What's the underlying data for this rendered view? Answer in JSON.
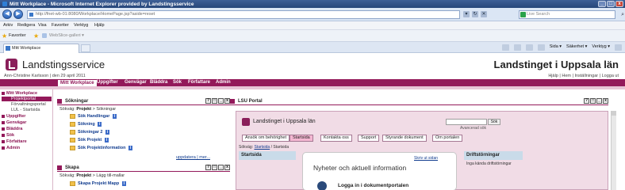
{
  "window": {
    "title": "Mitt Workplace - Microsoft Internet Explorer provided by Landstingsservice",
    "btn_min": "_",
    "btn_max": "□",
    "btn_close": "x"
  },
  "address": {
    "url": "http://fnet-wb-01:8080/Workplace/HomePage.jsp?aside=reset",
    "search_placeholder": "Live Search",
    "nav_back": "◀",
    "nav_fwd": "▶",
    "icons": [
      "▾",
      "↻",
      "✕"
    ],
    "search_icon": "⌕"
  },
  "menu": {
    "items": [
      "Arkiv",
      "Redigera",
      "Visa",
      "Favoriter",
      "Verktyg",
      "Hjälp"
    ]
  },
  "favorites": {
    "star": "★",
    "label": "Favoriter",
    "add": "★",
    "gallery": "WebSlice-galleri ▾"
  },
  "tabs": {
    "active": "Mitt Workplace"
  },
  "commandbar": {
    "items": [
      "Sida ▾",
      "Säkerhet ▾",
      "Verktyg ▾"
    ]
  },
  "header": {
    "site_title": "Landstingsservice",
    "org_title": "Landstinget i Uppsala län",
    "user_line": "Ann-Christine Karlsson | den 29 april 2011",
    "top_links": "Hjälp | Hem | Inställningar | Logga ut"
  },
  "nav": {
    "items": [
      "Mitt Workplace",
      "Uppgifter",
      "Genvägar",
      "Bläddra",
      "Sök",
      "Författare",
      "Admin"
    ]
  },
  "sidebar": {
    "top": "Mitt Workplace",
    "subs": [
      "Projektportal",
      "Förvaltningsportal",
      "LUL - Startsida"
    ],
    "items": [
      "Uppgifter",
      "Genvägar",
      "Bläddra",
      "Sök",
      "Författare",
      "Admin"
    ]
  },
  "sokningar": {
    "title": "Sökningar",
    "path_prefix": "Sökväg:",
    "path_bold": "Projekt",
    "path_rest": "> Sökningar",
    "items": [
      "Sök Handlingar",
      "Sökning",
      "Sökningar 2",
      "Sök Projekt",
      "Sök Projektinformation"
    ],
    "help": "i",
    "links": "uppdatera | mer..."
  },
  "skapa": {
    "title": "Skapa",
    "path_prefix": "Sökväg:",
    "path_bold": "Projekt",
    "path_rest": "> Lägg till-mallar",
    "items": [
      "Skapa Projekt Mapp"
    ]
  },
  "portlet_buttons": [
    "?",
    "□",
    "_",
    "x"
  ],
  "lsu": {
    "title": "LSU Portal",
    "inner_title": "Landstinget i Uppsala län",
    "search_btn": "Sök",
    "advanced": "Avancerad sök",
    "tabs": [
      "Ansök om behörighet",
      "Startsida",
      "Kontakta oss",
      "Support",
      "Styrande dokument",
      "Om portalen"
    ],
    "path_prefix": "Sökväg:",
    "path_link": "Startsida",
    "path_rest": "/ Startsida",
    "startsida_hdr": "Startsida",
    "skriv_ut": "Skriv ut sidan",
    "news_title": "Nyheter och aktuell information",
    "login_text": "Logga in i dokumentportalen",
    "drift_hdr": "Driftstörningar",
    "drift_text": "Inga kända driftstörningar"
  }
}
